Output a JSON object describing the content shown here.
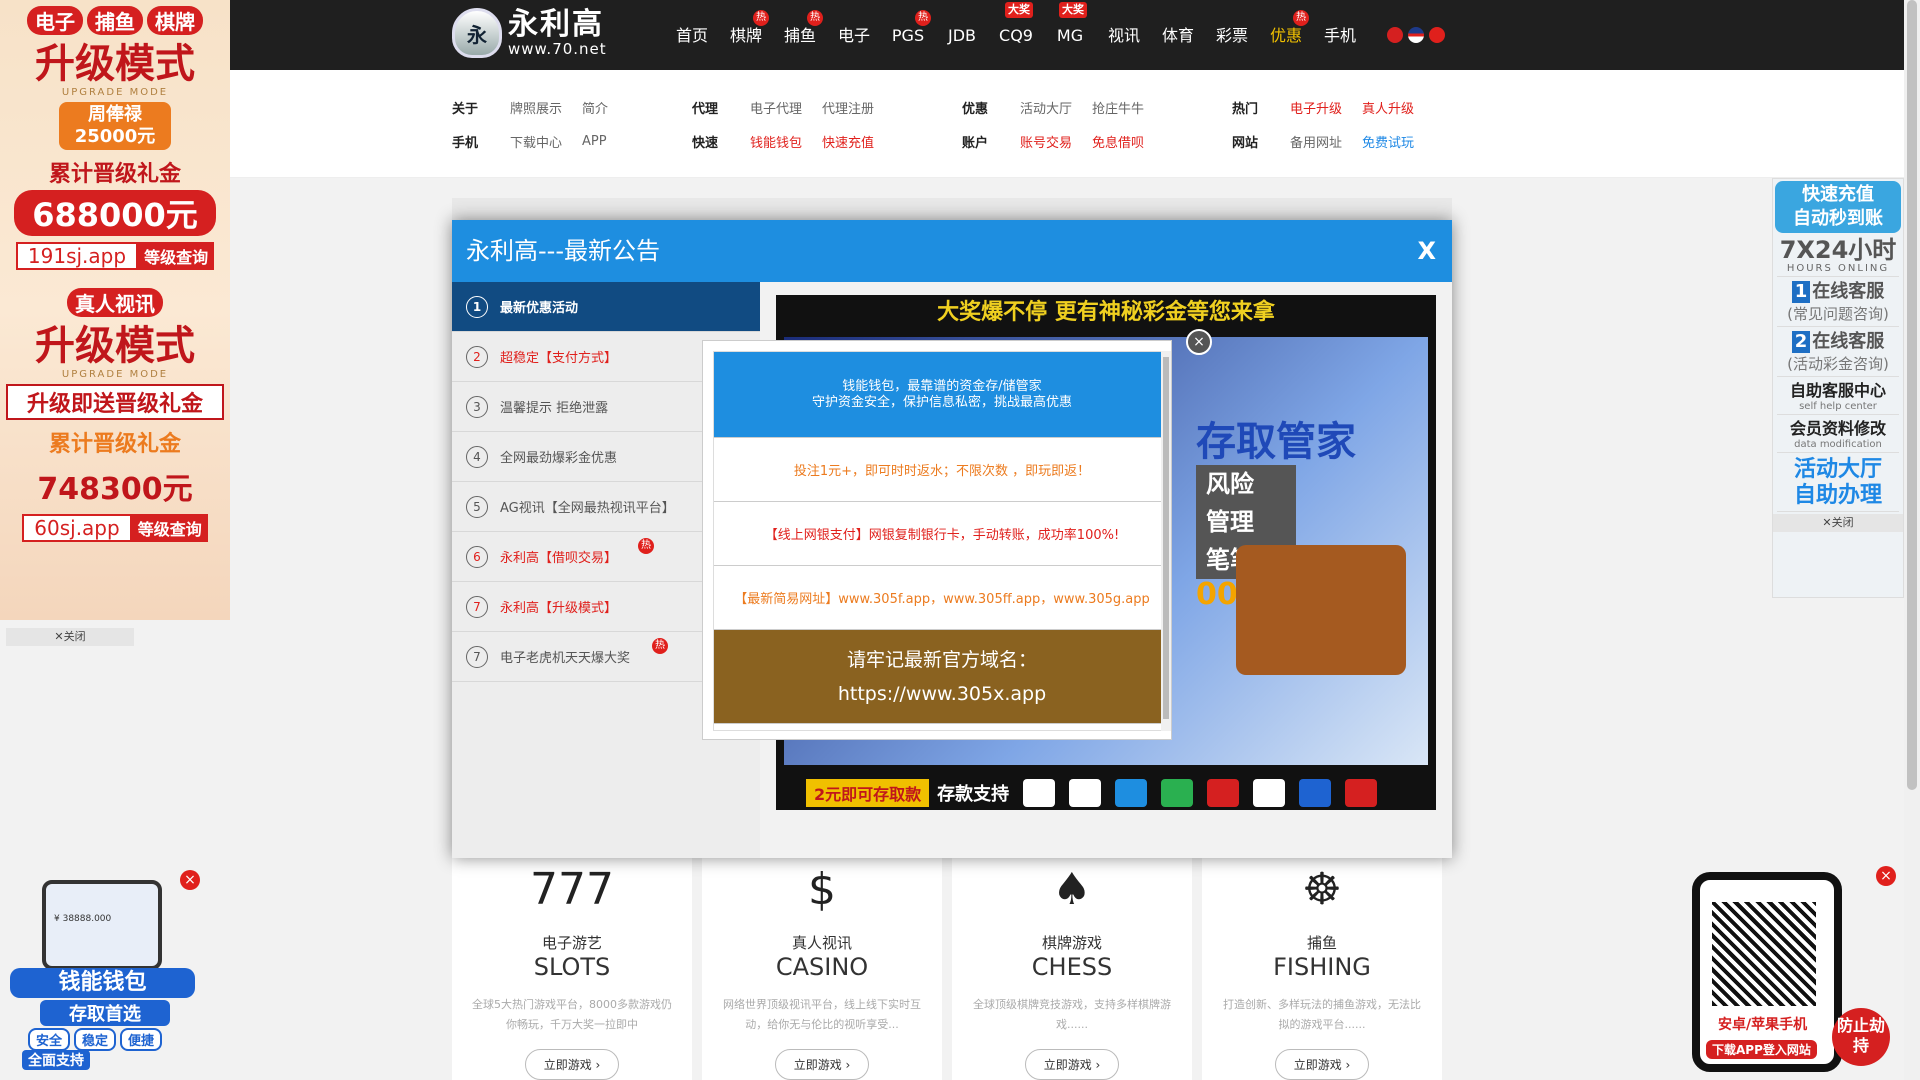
{
  "header": {
    "logo_name": "永利高",
    "logo_url": "www.70.net",
    "logo_badge": "永",
    "nav": [
      {
        "label": "首页",
        "badge": ""
      },
      {
        "label": "棋牌",
        "badge": "热"
      },
      {
        "label": "捕鱼",
        "badge": "热"
      },
      {
        "label": "电子",
        "badge": ""
      },
      {
        "label": "PGS",
        "badge": "热"
      },
      {
        "label": "JDB",
        "badge": ""
      },
      {
        "label": "CQ9",
        "badge": "大奖"
      },
      {
        "label": "MG",
        "badge": "大奖"
      },
      {
        "label": "视讯",
        "badge": ""
      },
      {
        "label": "体育",
        "badge": ""
      },
      {
        "label": "彩票",
        "badge": ""
      },
      {
        "label": "优惠",
        "badge": "热"
      },
      {
        "label": "手机",
        "badge": ""
      }
    ]
  },
  "submenu": [
    {
      "rows": [
        {
          "head": "关于",
          "links": [
            "牌照展示",
            "简介"
          ]
        },
        {
          "head": "手机",
          "links": [
            "下载中心",
            "APP"
          ]
        }
      ]
    },
    {
      "rows": [
        {
          "head": "代理",
          "links": [
            "电子代理",
            "代理注册"
          ]
        },
        {
          "head": "快速",
          "links": [
            "钱能钱包",
            "快速充值"
          ]
        }
      ]
    },
    {
      "rows": [
        {
          "head": "优惠",
          "links": [
            "活动大厅",
            "抢庄牛牛"
          ]
        },
        {
          "head": "账户",
          "links": [
            "账号交易",
            "免息借呗"
          ]
        }
      ]
    },
    {
      "rows": [
        {
          "head": "热门",
          "links": [
            "电子升级",
            "真人升级"
          ]
        },
        {
          "head": "网站",
          "links": [
            "备用网址",
            "免费试玩"
          ]
        }
      ]
    }
  ],
  "left_ad": {
    "chips": [
      "电子",
      "捕鱼",
      "棋牌"
    ],
    "title1": "升级模式",
    "en": "UPGRADE MODE",
    "box1": "周俸禄",
    "box1_amt": "25000元",
    "sub1": "累计晋级礼金",
    "amt1": "688000元",
    "domain1": "191sj.app",
    "query": "等级查询",
    "chip2": "真人视讯",
    "title2": "升级模式",
    "banner2": "升级即送晋级礼金",
    "sub2": "累计晋级礼金",
    "amt2": "748300元",
    "domain2": "60sj.app",
    "close": "关闭"
  },
  "right_ad": {
    "top": "快速充值",
    "top2": "自动秒到账",
    "hours": "7X24小时",
    "hours_en": "HOURS ONLING",
    "svc1": "在线客服",
    "svc1_sub": "(常见问题咨询)",
    "svc2": "在线客服",
    "svc2_sub": "(活动彩金咨询)",
    "self1": "自助客服中心",
    "self1_en": "self help center",
    "self2": "会员资料修改",
    "self2_en": "data modification",
    "act1": "活动大厅",
    "act2": "自助办理",
    "close": "关闭"
  },
  "modal": {
    "title": "永利高---最新公告",
    "close": "X",
    "tabs": [
      {
        "num": "1",
        "label": "最新优惠活动"
      },
      {
        "num": "2",
        "label": "超稳定【支付方式】"
      },
      {
        "num": "3",
        "label": "温馨提示 拒绝泄露"
      },
      {
        "num": "4",
        "label": "全网最劲爆彩金优惠"
      },
      {
        "num": "5",
        "label": "AG视讯【全网最热视讯平台】"
      },
      {
        "num": "6",
        "label": "永利高【借呗交易】"
      },
      {
        "num": "7",
        "label": "永利高【升级模式】"
      },
      {
        "num": "7",
        "label": "电子老虎机天天爆大奖"
      }
    ],
    "promo_top_1": "大奖爆不停 更有",
    "promo_top_2": "神秘彩金等您来拿",
    "promo_big": "存取管家",
    "promo_rows": [
      "风险",
      "管理",
      "笔笔送"
    ],
    "promo_pct": "00%",
    "promo_tag": "2元即可存取款",
    "promo_support": "存款支持"
  },
  "popup": {
    "r1a": "钱能钱包，最靠谱的资金存/储管家",
    "r1b": "守护资金安全，保护信息私密，挑战最高优惠",
    "r2": "投注1元+，即可时时返水；不限次数 ，即玩即返！",
    "r3": "【线上网银支付】网银复制银行卡，手动转账，成功率100%!",
    "r4": "【最新简易网址】www.305f.app，www.305ff.app，www.305g.app",
    "r5a": "请牢记最新官方域名：",
    "r5b": "https://www.305x.app",
    "close": "×"
  },
  "cards": [
    {
      "icon": "777",
      "cn": "电子游艺",
      "en": "SLOTS",
      "desc": "全球5大热门游戏平台，8000多款游戏仍你畅玩，千万大奖一拉即中",
      "btn": "立即游戏 ›"
    },
    {
      "icon": "$",
      "cn": "真人视讯",
      "en": "CASINO",
      "desc": "网络世界顶级视讯平台，线上线下实时互动，给你无与伦比的视听享受...",
      "btn": "立即游戏 ›"
    },
    {
      "icon": "♠",
      "cn": "棋牌游戏",
      "en": "CHESS",
      "desc": "全球顶级棋牌竞技游戏，支持多样棋牌游戏......",
      "btn": "立即游戏 ›"
    },
    {
      "icon": "☸",
      "cn": "捕鱼",
      "en": "FISHING",
      "desc": "打造创新、多样玩法的捕鱼游戏，无法比拟的游戏平台......",
      "btn": "立即游戏 ›"
    }
  ],
  "bl_ad": {
    "title": "钱能钱包",
    "sub": "存取首选",
    "tags": [
      "安全",
      "稳定",
      "便捷"
    ],
    "support": "全面支持",
    "balance": "¥ 38888.000"
  },
  "br_ad": {
    "l1": "安卓/苹果手机",
    "l2": "下载APP登入网站",
    "prevent": "防止劫持"
  }
}
